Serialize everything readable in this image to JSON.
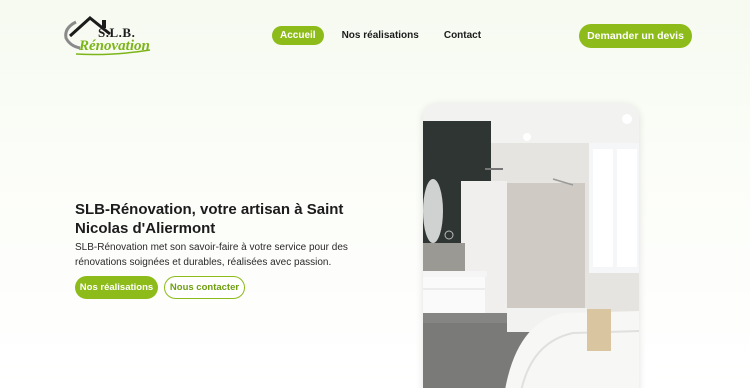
{
  "brand": {
    "name_top": "S.L.B.",
    "name_bottom": "Rénovation"
  },
  "nav": {
    "items": [
      {
        "label": "Accueil",
        "active": true
      },
      {
        "label": "Nos réalisations",
        "active": false
      },
      {
        "label": "Contact",
        "active": false
      }
    ],
    "cta_label": "Demander un devis"
  },
  "hero": {
    "title": "SLB-Rénovation, votre artisan à Saint Nicolas d'Aliermont",
    "text": "SLB-Rénovation met son savoir-faire à votre service pour des rénovations soignées et durables, réalisées avec passion.",
    "primary_button": "Nos réalisations",
    "secondary_button": "Nous contacter"
  },
  "colors": {
    "accent": "#8dbb1a",
    "background": "#f6faf0",
    "text": "#1c1c1c"
  },
  "icons": [
    "house-roof-logo-icon",
    "bathroom-photo"
  ]
}
